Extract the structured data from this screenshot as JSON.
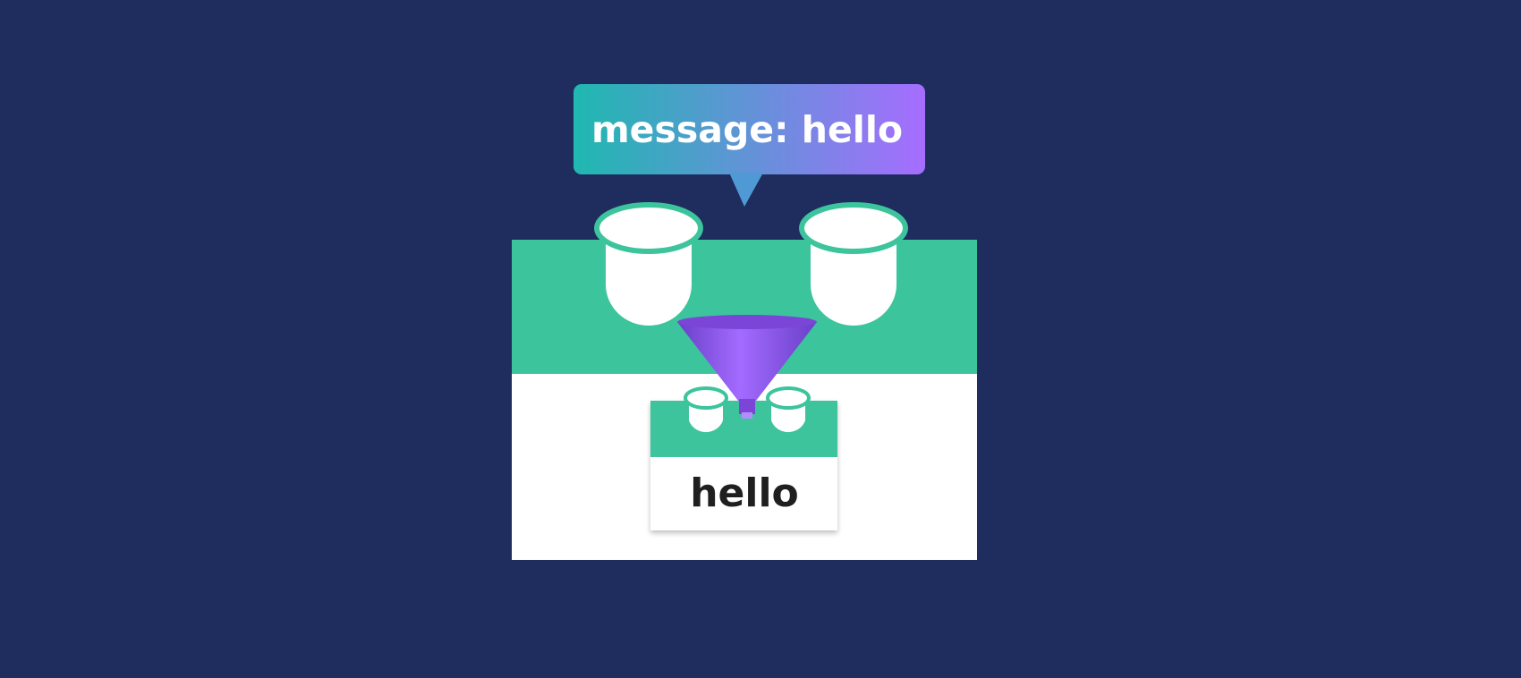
{
  "speech_bubble": {
    "text": "message: hello",
    "gradient_start": "#1fb8b0",
    "gradient_end": "#a66dff"
  },
  "child_component": {
    "text": "hello"
  },
  "colors": {
    "background": "#1f2c5e",
    "component_green": "#3cc49c",
    "component_white": "#ffffff",
    "funnel_purple": "#9b5ef5",
    "slot_outline": "#3cc49c"
  },
  "icons": {
    "slots": "cup-slot-icon",
    "funnel": "funnel-icon"
  }
}
